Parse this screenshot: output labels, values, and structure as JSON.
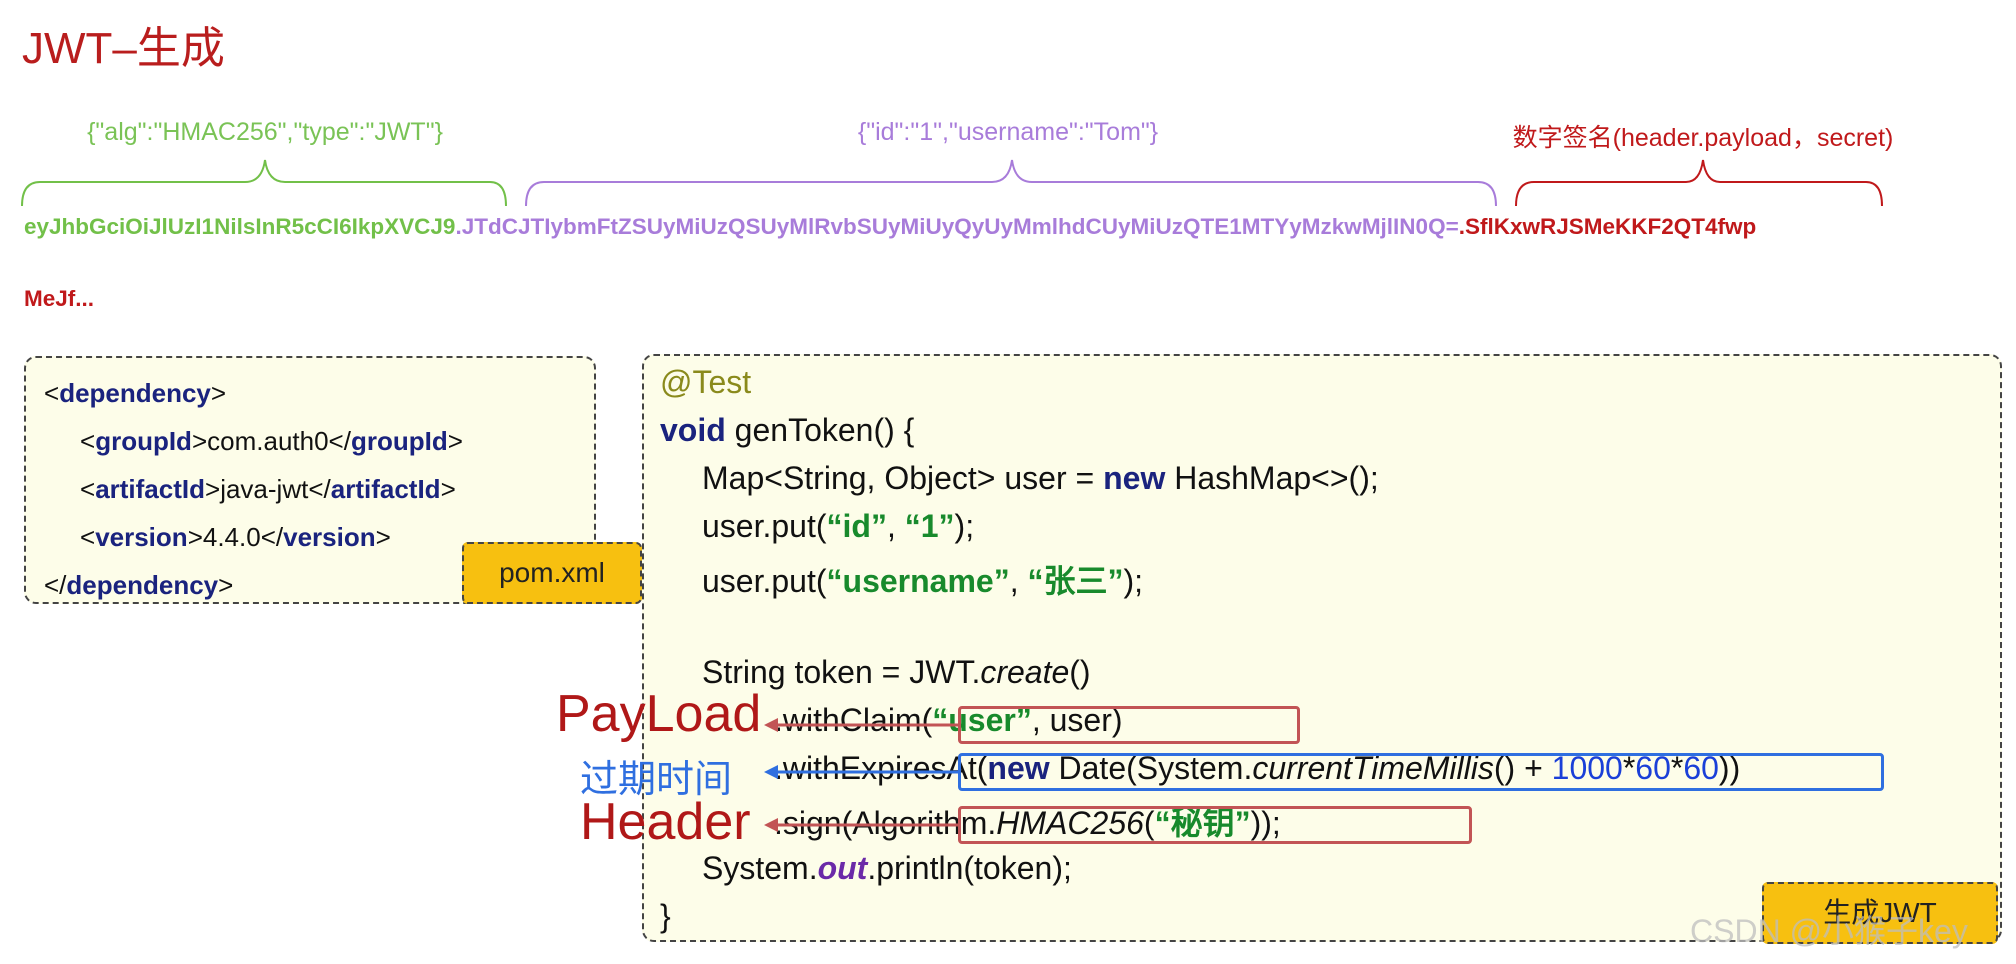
{
  "title": "JWT–生成",
  "segments": {
    "header_label": "{\"alg\":\"HMAC256\",\"type\":\"JWT\"}",
    "payload_label": "{\"id\":\"1\",\"username\":\"Tom\"}",
    "signature_label": "数字签名(header.payload，secret)"
  },
  "token": {
    "header_part": "eyJhbGciOiJlUzI1NilsInR5cCI6IkpXVCJ9",
    "dot1": ".",
    "payload_part": "JTdCJTIybmFtZSUyMiUzQSUyMlRvbSUyMiUyQyUyMmlhdCUyMiUzQTE1MTYyMzkwMjlIN0Q=",
    "dot2": ".",
    "signature_part": "SflKxwRJSMeKKF2QT4fwp",
    "signature_cont": "MeJf..."
  },
  "pom": {
    "tag_label": "pom.xml",
    "dependency": "dependency",
    "groupId": "groupId",
    "groupId_value": "com.auth0",
    "artifactId": "artifactId",
    "artifactId_value": "java-jwt",
    "version": "version",
    "version_value": "4.4.0"
  },
  "code": {
    "annotation": "@Test",
    "kw_void": "void",
    "method_sig": " genToken() {",
    "map_decl": "Map<String, Object> user = ",
    "kw_new": "new",
    "map_ctor": " HashMap<>();",
    "put1_a": "user.put(",
    "put1_key": "“id”",
    "put1_sep": ", ",
    "put1_val": "“1”",
    "put1_end": ");",
    "put2_a": "user.put(",
    "put2_key": "“username”",
    "put2_sep": ", ",
    "put2_val": "“张三”",
    "put2_end": ");",
    "token_decl": "String token = JWT.",
    "create": "create",
    "create_end": "()",
    "with_claim": ".withClaim(",
    "claim_key": "“user”",
    "claim_end": ", user)",
    "with_expires": ".withExpires",
    "expires_at": "At(",
    "expires_new": "new",
    "expires_date": " Date(System.",
    "current_millis": "currentTimeMillis",
    "expires_plus": "() + ",
    "n1000": "1000",
    "times1": "*",
    "n60a": "60",
    "times2": "*",
    "n60b": "60",
    "expires_end": "))",
    "sign_a": ".sign(Algo",
    "sign_b": "rithm.",
    "hmac": "HMAC256",
    "sign_paren": "(",
    "secret": "“秘钥”",
    "sign_end": "));",
    "println_a": "System.",
    "out": "out",
    "println_b": ".println(token);",
    "close_brace": "}",
    "tag_label": "生成JWT"
  },
  "callouts": {
    "payload": "PayLoad",
    "expiry": "过期时间",
    "header": "Header"
  },
  "watermark": "CSDN @小猴子key",
  "colors": {
    "title_red": "#b91d1d",
    "header_green": "#72c049",
    "payload_purple": "#a87cda",
    "signature_red": "#c0191b",
    "box_fill": "#fdfde9",
    "tag_orange": "#f7c010",
    "highlight_red": "#c25455",
    "highlight_blue": "#2f6fe0"
  }
}
